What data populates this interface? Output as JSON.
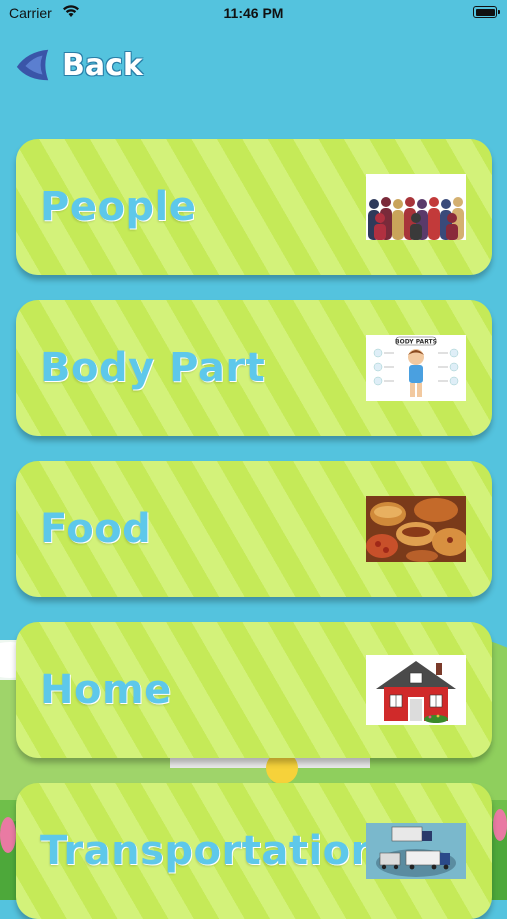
{
  "status_bar": {
    "carrier": "Carrier",
    "time": "11:46 PM"
  },
  "nav": {
    "back_label": "Back"
  },
  "categories": [
    {
      "label": "People",
      "thumbnail": "crowd-silhouettes-image"
    },
    {
      "label": "Body Part",
      "thumbnail": "body-parts-chart-image",
      "thumbnail_text": "BODY PARTS"
    },
    {
      "label": "Food",
      "thumbnail": "fast-food-pile-image"
    },
    {
      "label": "Home",
      "thumbnail": "red-house-image"
    },
    {
      "label": "Transportation",
      "thumbnail": "trucks-image"
    }
  ],
  "colors": {
    "background": "#54c3de",
    "card_light": "#d3f27a",
    "card_stripe": "#c5ea58",
    "label": "#5ec8ea",
    "back_icon": "#3a55a8"
  }
}
